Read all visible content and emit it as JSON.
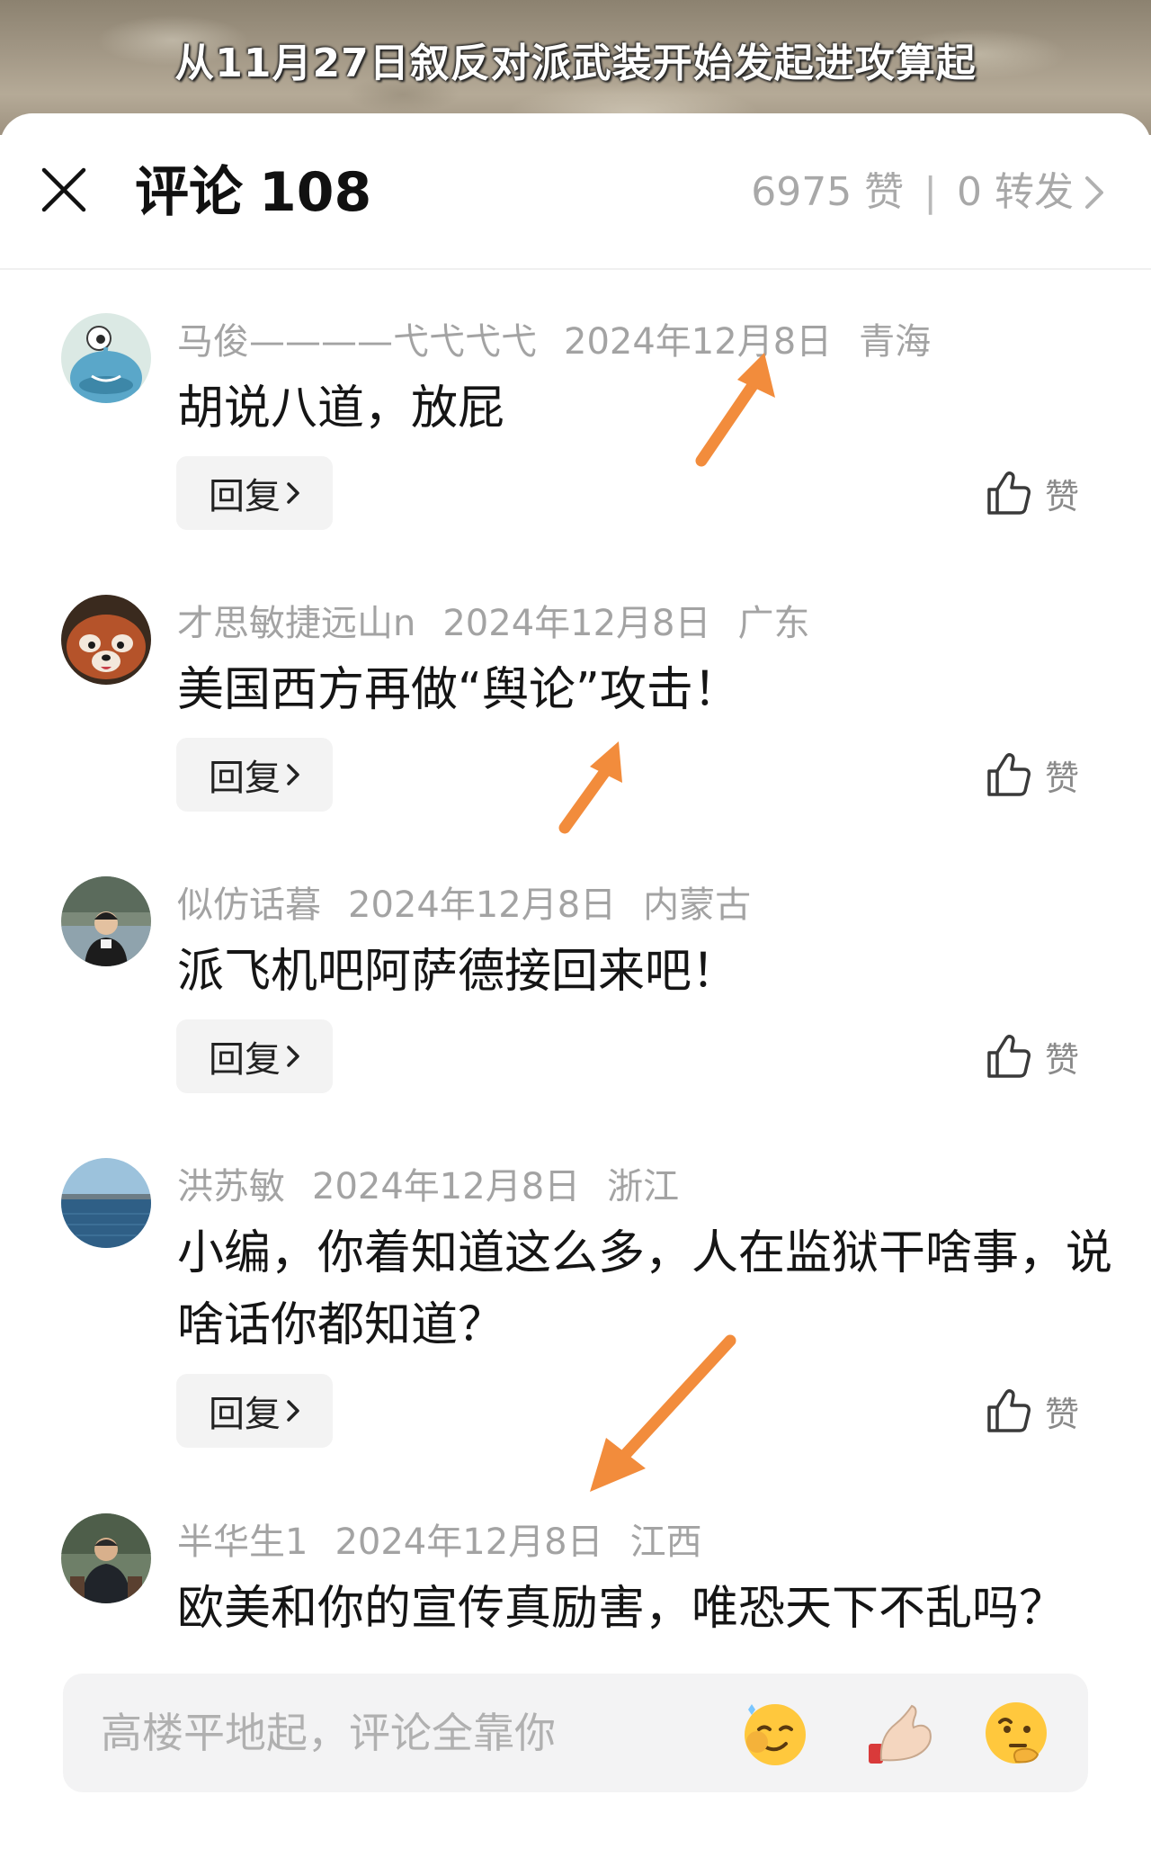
{
  "video": {
    "caption": "从11月27日叙反对派武装开始发起进攻算起"
  },
  "header": {
    "title": "评论",
    "count": "108",
    "likes": "6975 赞",
    "divider": "|",
    "shares": "0 转发"
  },
  "comments": [
    {
      "username": "马俊————弋弋弋弋",
      "date": "2024年12月8日",
      "location": "青海",
      "text": "胡说八道，放屁",
      "reply_label": "回复",
      "like_label": "赞",
      "avatar": "cartoon-monster-avatar"
    },
    {
      "username": "才思敏捷远山n",
      "date": "2024年12月8日",
      "location": "广东",
      "text": "美国西方再做“舆论”攻击！",
      "reply_label": "回复",
      "like_label": "赞",
      "avatar": "red-panda-avatar"
    },
    {
      "username": "似仿话暮",
      "date": "2024年12月8日",
      "location": "内蒙古",
      "text": "派飞机吧阿萨德接回来吧！",
      "reply_label": "回复",
      "like_label": "赞",
      "avatar": "person-outdoor-avatar"
    },
    {
      "username": "洪苏敏",
      "date": "2024年12月8日",
      "location": "浙江",
      "text": "小编，你着知道这么多，人在监狱干啥事，说啥话你都知道？",
      "reply_label": "回复",
      "like_label": "赞",
      "avatar": "lake-landscape-avatar"
    },
    {
      "username": "半华生1",
      "date": "2024年12月8日",
      "location": "江西",
      "text": "欧美和你的宣传真励害，唯恐天下不乱吗？",
      "avatar": "seated-man-avatar"
    }
  ],
  "input": {
    "placeholder": "高楼平地起，评论全靠你"
  },
  "emojis": [
    "smirk-emoji",
    "pinch-hand-emoji",
    "thinking-emoji"
  ],
  "colors": {
    "annotation_arrow": "#f28c3c",
    "meta_text": "#a3a3a3"
  }
}
